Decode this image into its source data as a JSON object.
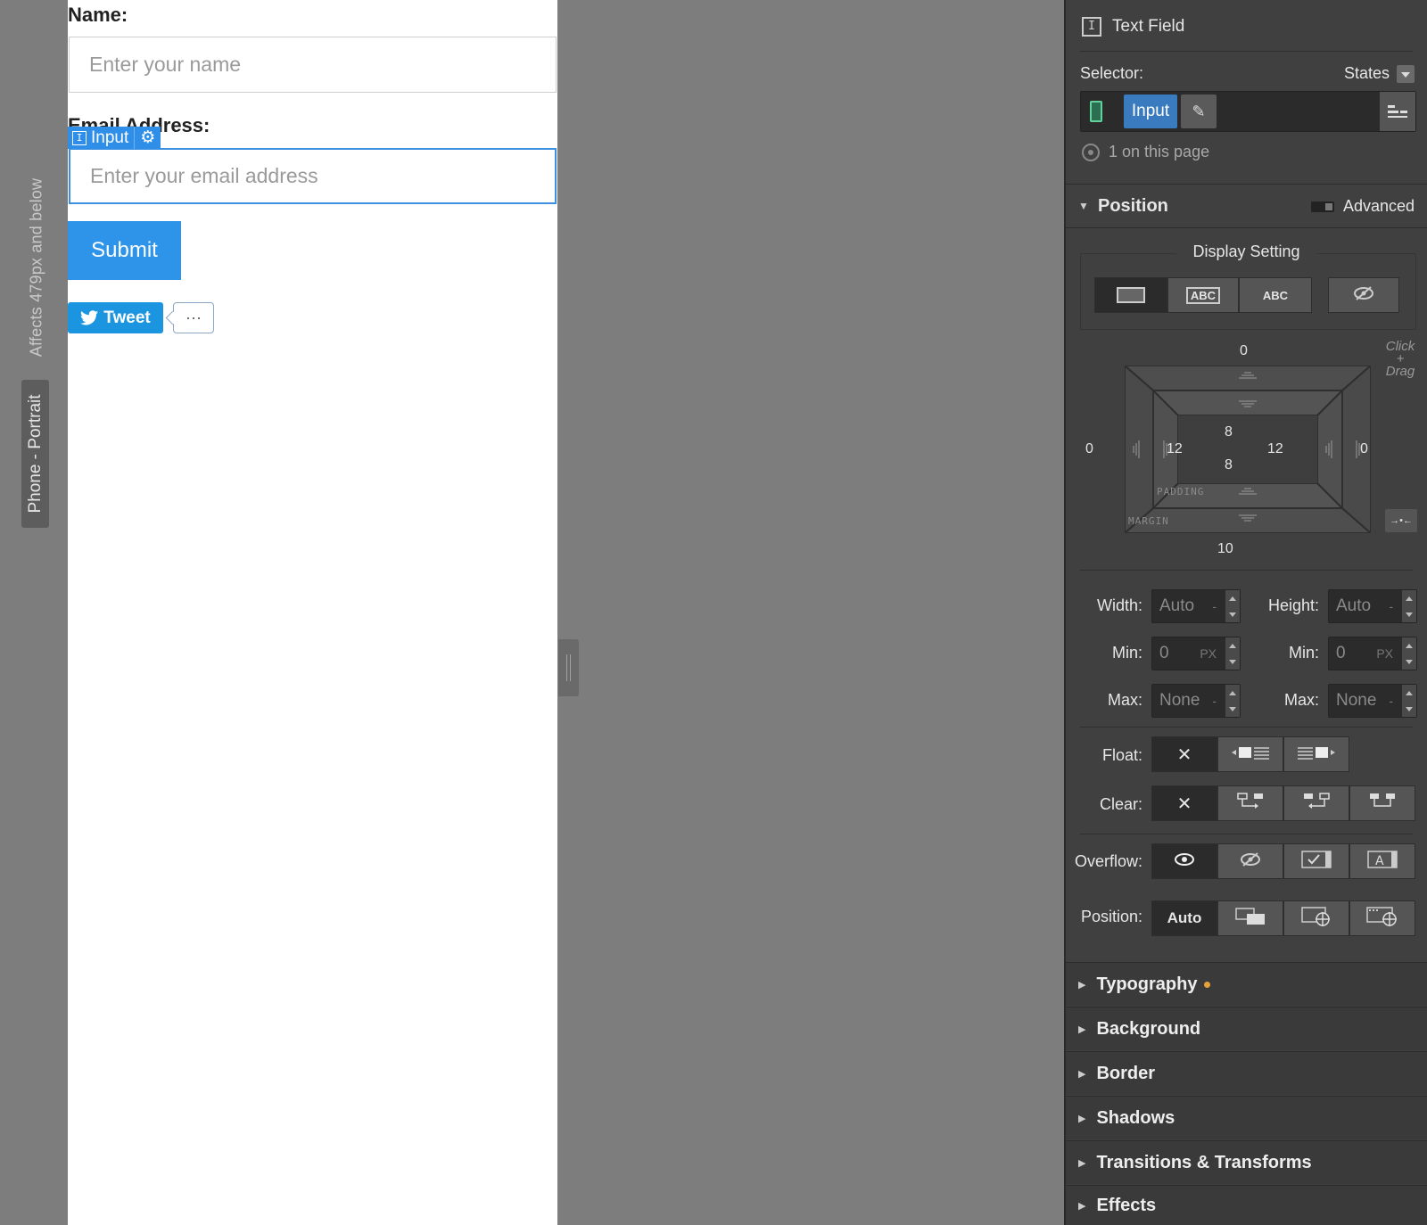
{
  "breakpoint": {
    "affects_text": "Affects 479px and below",
    "device_label": "Phone - Portrait"
  },
  "canvas": {
    "name_label": "Name:",
    "name_placeholder": "Enter your name",
    "email_label": "Email Address:",
    "email_placeholder": "Enter your email address",
    "selected_badge": "Input",
    "submit_label": "Submit",
    "tweet_label": "Tweet",
    "tweet_count": "···"
  },
  "panel": {
    "element_type": "Text Field",
    "selector_label": "Selector:",
    "states_label": "States",
    "selector_tag": "Input",
    "on_page": "1 on this page",
    "position_section": "Position",
    "advanced_label": "Advanced",
    "display_setting_label": "Display Setting",
    "display_options": [
      "",
      "ABC",
      "ABC",
      ""
    ],
    "box_model": {
      "margin_top": "0",
      "margin_bottom": "10",
      "margin_left": "0",
      "margin_right": "0",
      "padding_top": "8",
      "padding_bottom": "8",
      "padding_left": "12",
      "padding_right": "12",
      "padding_label": "PADDING",
      "margin_label": "MARGIN",
      "hint": "Click + Drag"
    },
    "size": {
      "width_label": "Width:",
      "width_value": "Auto",
      "width_unit": "-",
      "height_label": "Height:",
      "height_value": "Auto",
      "height_unit": "-",
      "min_label": "Min:",
      "min_width": "0",
      "min_width_unit": "PX",
      "min_height": "0",
      "min_height_unit": "PX",
      "max_label": "Max:",
      "max_width": "None",
      "max_width_unit": "-",
      "max_height": "None",
      "max_height_unit": "-"
    },
    "float_label": "Float:",
    "clear_label": "Clear:",
    "overflow_label": "Overflow:",
    "position_label": "Position:",
    "position_auto": "Auto",
    "none_glyph": "✕",
    "sections": [
      "Typography",
      "Background",
      "Border",
      "Shadows",
      "Transitions & Transforms",
      "Effects"
    ]
  }
}
